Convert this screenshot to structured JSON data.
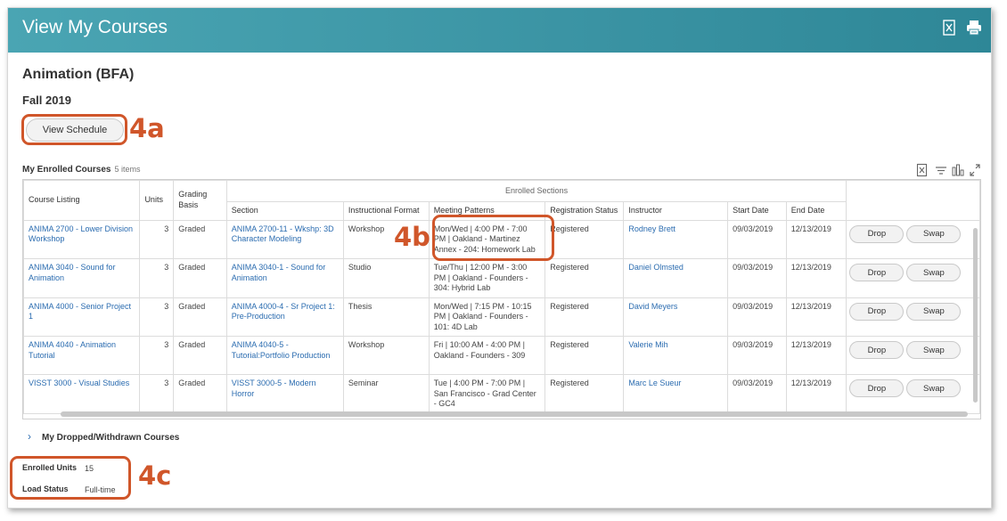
{
  "header": {
    "title": "View My Courses"
  },
  "program": "Animation (BFA)",
  "term": "Fall 2019",
  "view_schedule_label": "View Schedule",
  "callouts": {
    "a": "4a",
    "b": "4b",
    "c": "4c"
  },
  "grid": {
    "title": "My Enrolled Courses",
    "count": "5 items",
    "group_header": "Enrolled Sections",
    "columns": {
      "course_listing": "Course Listing",
      "units": "Units",
      "grading_basis": "Grading Basis",
      "section": "Section",
      "instructional_format": "Instructional Format",
      "meeting_patterns": "Meeting Patterns",
      "registration_status": "Registration Status",
      "instructor": "Instructor",
      "start_date": "Start Date",
      "end_date": "End Date"
    },
    "rows": [
      {
        "course": "ANIMA 2700 - Lower Division Workshop",
        "units": "3",
        "grading": "Graded",
        "section": "ANIMA 2700-11 - Wkshp: 3D Character Modeling",
        "format": "Workshop",
        "meeting": "Mon/Wed | 4:00 PM - 7:00 PM | Oakland - Martinez Annex - 204: Homework Lab",
        "status": "Registered",
        "instructor": "Rodney Brett",
        "start": "09/03/2019",
        "end": "12/13/2019",
        "drop": "Drop",
        "swap": "Swap"
      },
      {
        "course": "ANIMA 3040 - Sound for Animation",
        "units": "3",
        "grading": "Graded",
        "section": "ANIMA 3040-1 - Sound for Animation",
        "format": "Studio",
        "meeting": "Tue/Thu | 12:00 PM - 3:00 PM | Oakland - Founders - 304: Hybrid Lab",
        "status": "Registered",
        "instructor": "Daniel Olmsted",
        "start": "09/03/2019",
        "end": "12/13/2019",
        "drop": "Drop",
        "swap": "Swap"
      },
      {
        "course": "ANIMA 4000 - Senior Project 1",
        "units": "3",
        "grading": "Graded",
        "section": "ANIMA 4000-4 - Sr Project 1: Pre-Production",
        "format": "Thesis",
        "meeting": "Mon/Wed | 7:15 PM - 10:15 PM | Oakland - Founders - 101: 4D Lab",
        "status": "Registered",
        "instructor": "David Meyers",
        "start": "09/03/2019",
        "end": "12/13/2019",
        "drop": "Drop",
        "swap": "Swap"
      },
      {
        "course": "ANIMA 4040 - Animation Tutorial",
        "units": "3",
        "grading": "Graded",
        "section": "ANIMA 4040-5 - Tutorial:Portfolio Production",
        "format": "Workshop",
        "meeting": "Fri | 10:00 AM - 4:00 PM | Oakland - Founders - 309",
        "status": "Registered",
        "instructor": "Valerie Mih",
        "start": "09/03/2019",
        "end": "12/13/2019",
        "drop": "Drop",
        "swap": "Swap"
      },
      {
        "course": "VISST 3000 - Visual Studies",
        "units": "3",
        "grading": "Graded",
        "section": "VISST 3000-5 - Modern Horror",
        "format": "Seminar",
        "meeting": "Tue | 4:00 PM - 7:00 PM | San Francisco - Grad Center - GC4",
        "status": "Registered",
        "instructor": "Marc Le Sueur",
        "start": "09/03/2019",
        "end": "12/13/2019",
        "drop": "Drop",
        "swap": "Swap"
      }
    ]
  },
  "dropped_label": "My Dropped/Withdrawn Courses",
  "summary": {
    "enrolled_units_label": "Enrolled Units",
    "enrolled_units_value": "15",
    "load_status_label": "Load Status",
    "load_status_value": "Full-time"
  },
  "colors": {
    "header": "#3a93a3",
    "link": "#2b6cb0",
    "callout": "#d0562a"
  }
}
